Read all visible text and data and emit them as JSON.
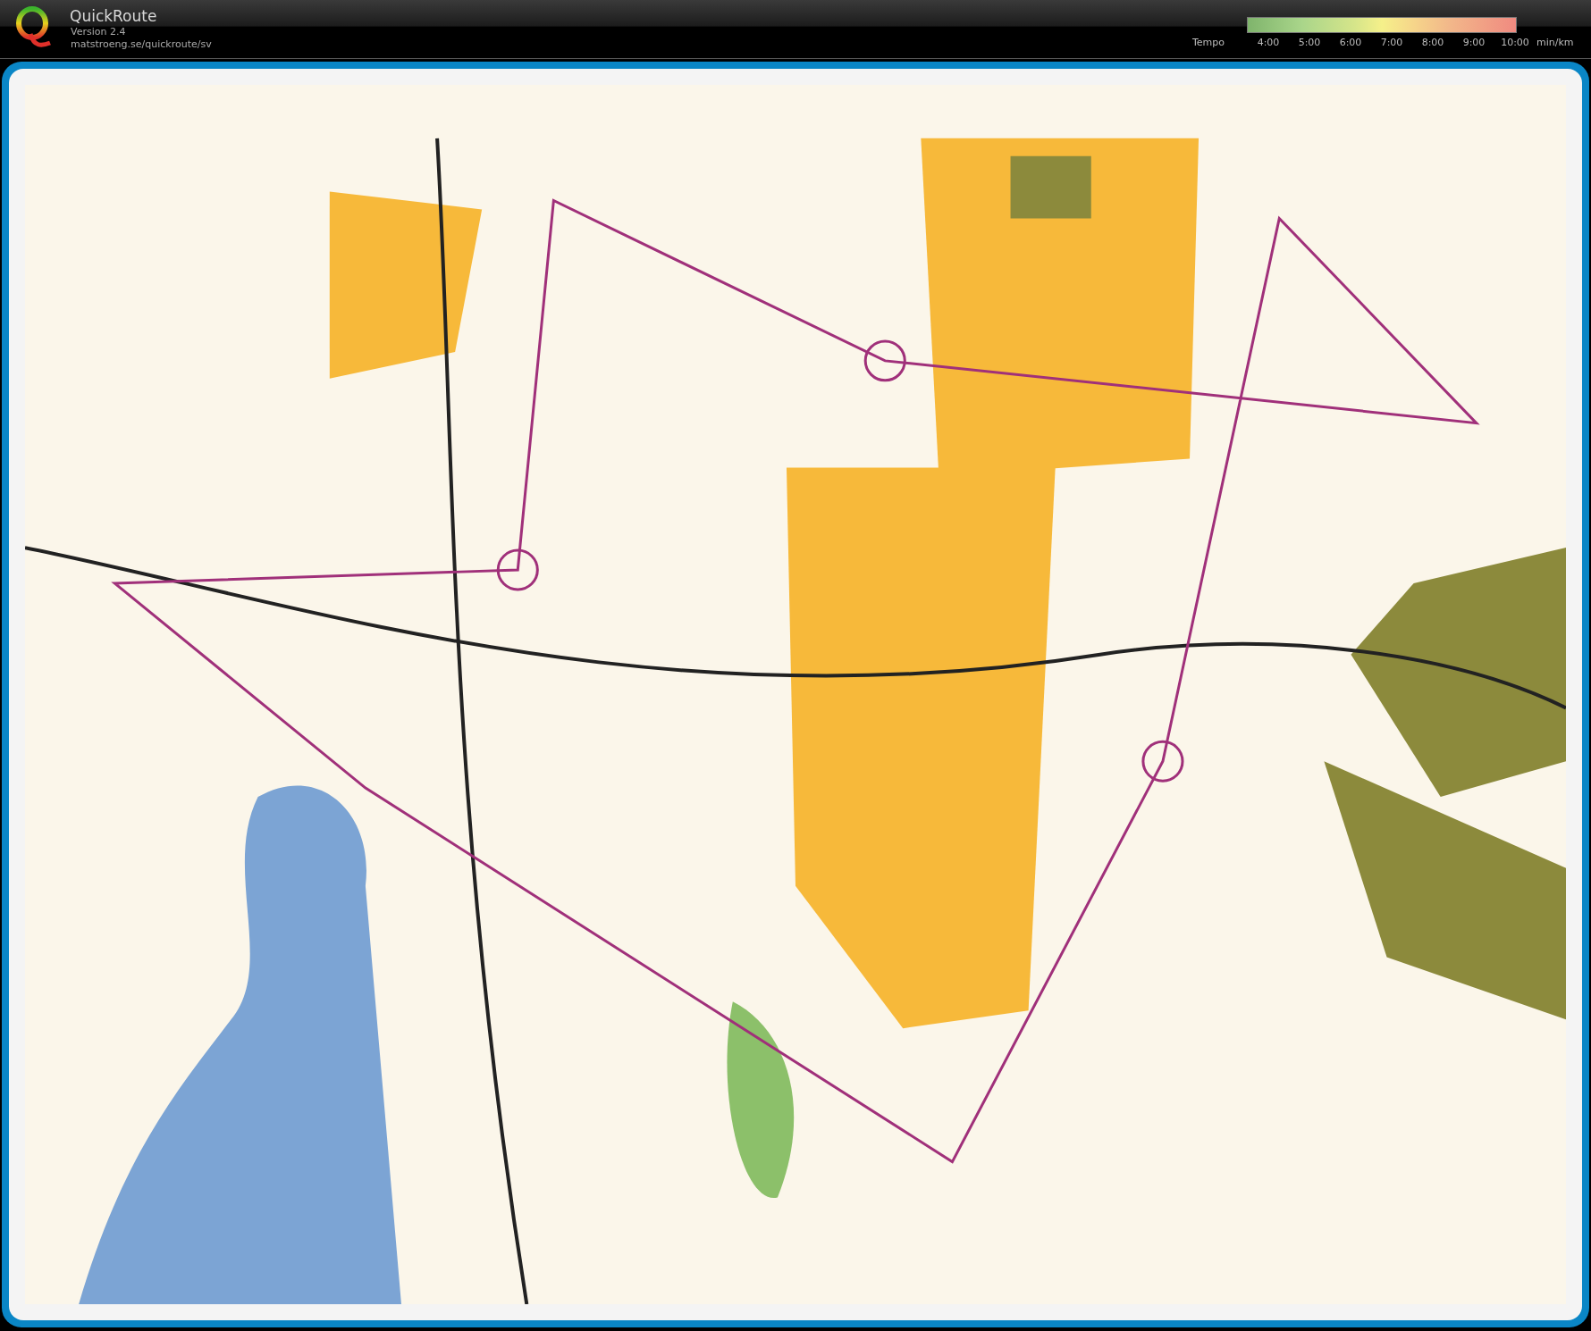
{
  "app": {
    "name": "QuickRoute",
    "version": "Version 2.4",
    "url": "matstroeng.se/quickroute/sv"
  },
  "legend": {
    "label": "Tempo",
    "ticks": [
      "4:00",
      "5:00",
      "6:00",
      "7:00",
      "8:00",
      "9:00",
      "10:00"
    ],
    "unit": "min/km"
  }
}
